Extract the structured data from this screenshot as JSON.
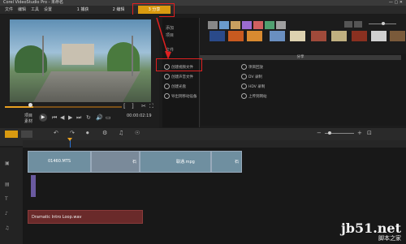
{
  "app": {
    "title": "Corel VideoStudio Pro - 未命名"
  },
  "menu": {
    "items": [
      "文件",
      "编辑",
      "工具",
      "设置"
    ]
  },
  "steps": [
    {
      "label": "捕获",
      "active": false
    },
    {
      "label": "编辑",
      "active": false
    },
    {
      "label": "分享",
      "active": true
    }
  ],
  "preview": {
    "mode_label": "项目",
    "clip_label": "素材",
    "timecode": "00:00:02:19"
  },
  "library": {
    "sidebar": [
      "添加",
      "项目",
      "文件"
    ],
    "share_header": "分享",
    "share_items": [
      "创建视频文件",
      "创建声音文件",
      "创建光盘",
      "导出到移动设备",
      "项目回放",
      "DV 录制",
      "HDV 录制",
      "上传到网站"
    ]
  },
  "timeline": {
    "clips": [
      "01460.MTS",
      "石",
      "联通.mpg",
      "石"
    ],
    "audio_clip": "Dramatic Intro Loop.wav"
  },
  "watermark": {
    "main": "jb51.net",
    "sub": "脚本之家"
  },
  "colors": {
    "accent": "#d99a10",
    "highlight": "#e02020",
    "playhead": "#2a70d0"
  }
}
